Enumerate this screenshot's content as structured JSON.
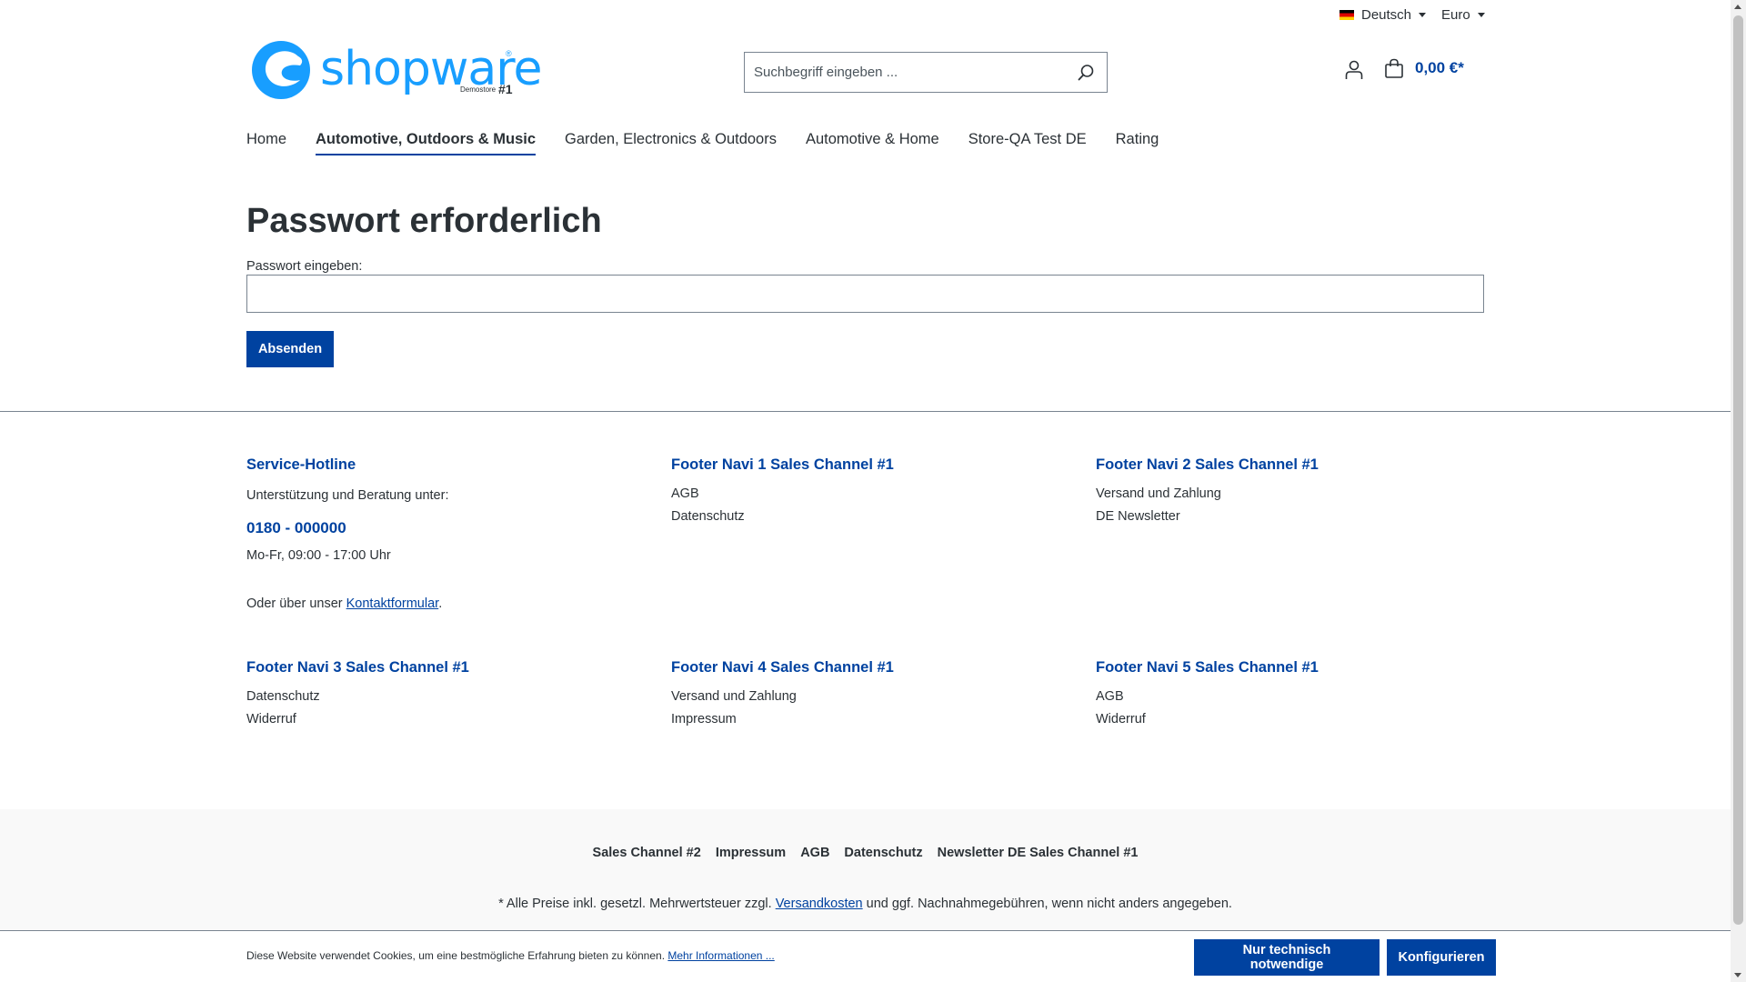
{
  "topbar": {
    "language": "Deutsch",
    "currency": "Euro"
  },
  "header": {
    "logo_text": "shopware",
    "logo_reg": "®",
    "logo_demo": "Demostore",
    "logo_num": "#1",
    "search_placeholder": "Suchbegriff eingeben ...",
    "cart_total": "0,00 €*"
  },
  "nav": {
    "items": [
      {
        "label": "Home"
      },
      {
        "label": "Automotive, Outdoors & Music"
      },
      {
        "label": "Garden, Electronics & Outdoors"
      },
      {
        "label": "Automotive & Home"
      },
      {
        "label": "Store-QA Test DE"
      },
      {
        "label": "Rating"
      }
    ]
  },
  "main": {
    "title": "Passwort erforderlich",
    "password_label": "Passwort eingeben:",
    "submit_label": "Absenden"
  },
  "footer": {
    "hotline": {
      "heading": "Service-Hotline",
      "intro": "Unterstützung und Beratung unter:",
      "number": "0180 - 000000",
      "hours": "Mo-Fr, 09:00 - 17:00 Uhr",
      "contact_prefix": "Oder über unser ",
      "contact_link": "Kontaktformular",
      "contact_suffix": "."
    },
    "navi1": {
      "heading": "Footer Navi 1 Sales Channel #1",
      "links": [
        "AGB",
        "Datenschutz"
      ]
    },
    "navi2": {
      "heading": "Footer Navi 2 Sales Channel #1",
      "links": [
        "Versand und Zahlung",
        "DE Newsletter"
      ]
    },
    "navi3": {
      "heading": "Footer Navi 3 Sales Channel #1",
      "links": [
        "Datenschutz",
        "Widerruf"
      ]
    },
    "navi4": {
      "heading": "Footer Navi 4 Sales Channel #1",
      "links": [
        "Versand und Zahlung",
        "Impressum"
      ]
    },
    "navi5": {
      "heading": "Footer Navi 5 Sales Channel #1",
      "links": [
        "AGB",
        "Widerruf"
      ]
    },
    "service_menu": [
      "Sales Channel #2",
      "Impressum",
      "AGB",
      "Datenschutz",
      "Newsletter DE Sales Channel #1"
    ],
    "vat_prefix": "* Alle Preise inkl. gesetzl. Mehrwertsteuer zzgl. ",
    "vat_link": "Versandkosten",
    "vat_suffix": " und ggf. Nachnahmegebühren, wenn nicht anders angegeben."
  },
  "cookie": {
    "text": "Diese Website verwendet Cookies, um eine bestmögliche Erfahrung bieten zu können. ",
    "more_link": "Mehr Informationen ...",
    "btn_necessary": "Nur technisch notwendige",
    "btn_configure": "Konfigurieren"
  },
  "colors": {
    "brand": "#0042a0",
    "logo_blue": "#189eff",
    "text": "#2b3136"
  },
  "icons": {
    "search": "search-icon",
    "account": "user-icon",
    "cart": "bag-icon",
    "flag": "flag-de-icon"
  }
}
